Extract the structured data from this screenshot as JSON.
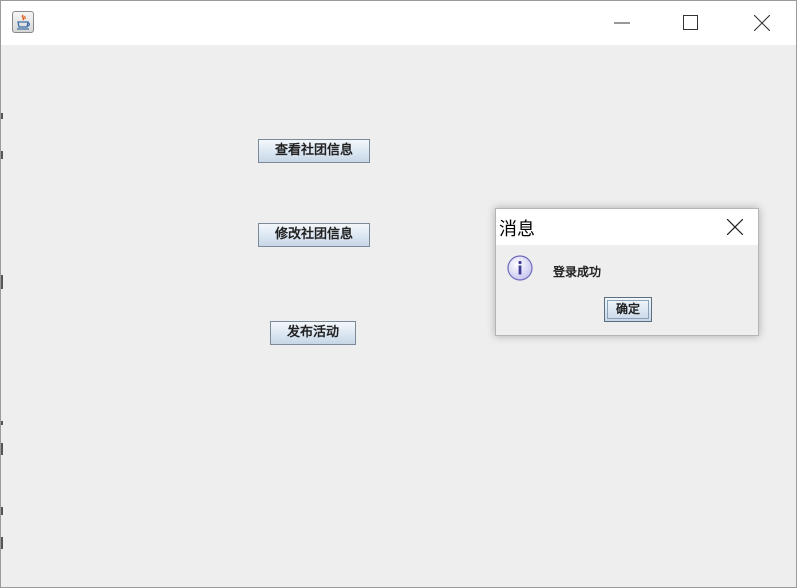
{
  "window": {
    "app_icon": "java-cup-icon",
    "controls": {
      "minimize_icon": "minimize-icon",
      "maximize_icon": "maximize-icon",
      "close_icon": "close-icon"
    }
  },
  "main": {
    "buttons": [
      {
        "label": "查看社团信息"
      },
      {
        "label": "修改社团信息"
      },
      {
        "label": "发布活动"
      }
    ]
  },
  "dialog": {
    "title": "消息",
    "message": "登录成功",
    "icon": "information-icon",
    "ok_label": "确定",
    "close_icon": "close-icon"
  },
  "colors": {
    "background": "#eeeeee",
    "titlebar": "#ffffff",
    "button_border": "#7a8a99",
    "info_icon_fill": "#c9c7f0"
  }
}
